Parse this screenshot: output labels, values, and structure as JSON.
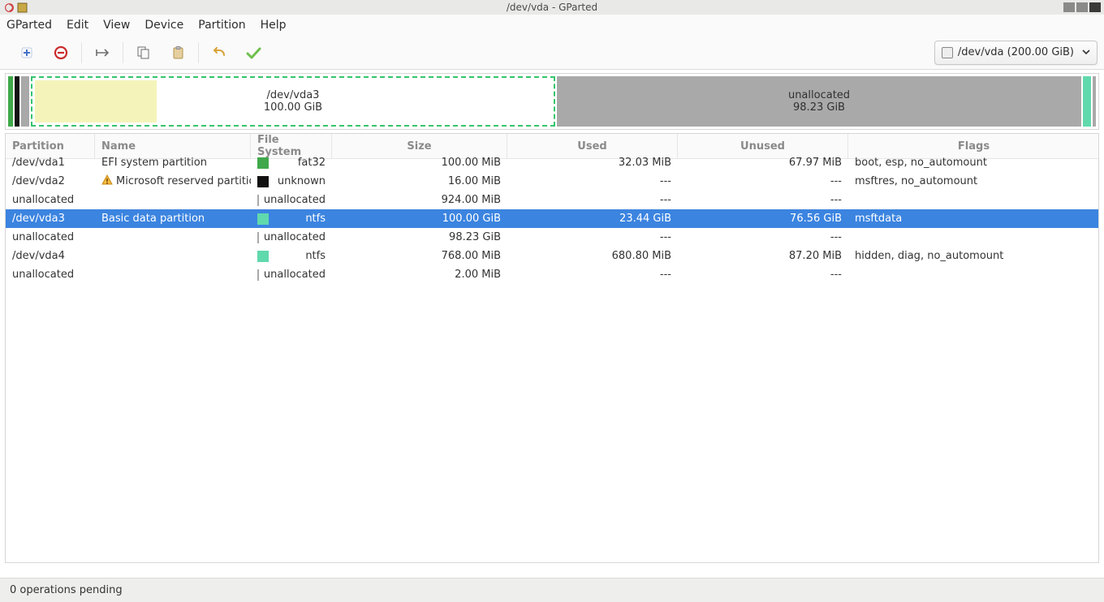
{
  "window": {
    "title": "/dev/vda - GParted"
  },
  "menu": {
    "gparted": "GParted",
    "edit": "Edit",
    "view": "View",
    "device": "Device",
    "partition": "Partition",
    "help": "Help"
  },
  "device_selector": {
    "label": "/dev/vda (200.00 GiB)"
  },
  "diskmap": {
    "vda3": {
      "name": "/dev/vda3",
      "size": "100.00 GiB"
    },
    "unallocated": {
      "name": "unallocated",
      "size": "98.23 GiB"
    }
  },
  "columns": {
    "partition": "Partition",
    "name": "Name",
    "fs": "File System",
    "size": "Size",
    "used": "Used",
    "unused": "Unused",
    "flags": "Flags"
  },
  "rows": [
    {
      "partition": "/dev/vda1",
      "warn": false,
      "name": "EFI system partition",
      "fs": "fat32",
      "sw": "fat32",
      "size": "100.00 MiB",
      "used": "32.03 MiB",
      "unused": "67.97 MiB",
      "flags": "boot, esp, no_automount",
      "sel": false
    },
    {
      "partition": "/dev/vda2",
      "warn": true,
      "name": "Microsoft reserved partition",
      "fs": "unknown",
      "sw": "unknown",
      "size": "16.00 MiB",
      "used": "---",
      "unused": "---",
      "flags": "msftres, no_automount",
      "sel": false
    },
    {
      "partition": "unallocated",
      "warn": false,
      "name": "",
      "fs": "unallocated",
      "sw": "unalloc",
      "size": "924.00 MiB",
      "used": "---",
      "unused": "---",
      "flags": "",
      "sel": false
    },
    {
      "partition": "/dev/vda3",
      "warn": false,
      "name": "Basic data partition",
      "fs": "ntfs",
      "sw": "ntfs",
      "size": "100.00 GiB",
      "used": "23.44 GiB",
      "unused": "76.56 GiB",
      "flags": "msftdata",
      "sel": true
    },
    {
      "partition": "unallocated",
      "warn": false,
      "name": "",
      "fs": "unallocated",
      "sw": "unalloc",
      "size": "98.23 GiB",
      "used": "---",
      "unused": "---",
      "flags": "",
      "sel": false
    },
    {
      "partition": "/dev/vda4",
      "warn": false,
      "name": "",
      "fs": "ntfs",
      "sw": "ntfs",
      "size": "768.00 MiB",
      "used": "680.80 MiB",
      "unused": "87.20 MiB",
      "flags": "hidden, diag, no_automount",
      "sel": false
    },
    {
      "partition": "unallocated",
      "warn": false,
      "name": "",
      "fs": "unallocated",
      "sw": "unalloc",
      "size": "2.00 MiB",
      "used": "---",
      "unused": "---",
      "flags": "",
      "sel": false
    }
  ],
  "status": {
    "pending": "0 operations pending"
  }
}
